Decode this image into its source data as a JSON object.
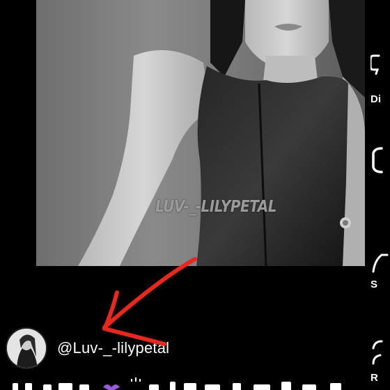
{
  "video": {
    "watermark": "LUV-_-LILYPETAL"
  },
  "action_rail": {
    "items": [
      {
        "icon": "thumbs-down-icon",
        "label": "Di"
      },
      {
        "icon": "comment-icon",
        "label": ""
      },
      {
        "icon": "share-icon",
        "label": "S"
      },
      {
        "icon": "remix-icon",
        "label": "R"
      }
    ]
  },
  "author": {
    "handle": "@Luv-_-lilypetal"
  },
  "annotation": {
    "arrow_color": "#e8281e"
  }
}
